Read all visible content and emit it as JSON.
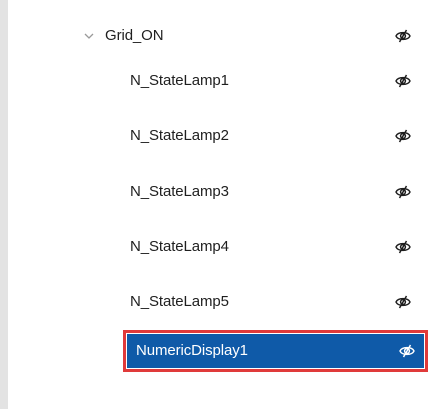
{
  "tree": {
    "group": {
      "label": "Grid_ON",
      "expanded": true,
      "expand_icon": "chevron-down-icon",
      "visibility_icon": "eye-icon"
    },
    "children": [
      {
        "label": "N_StateLamp1",
        "visibility_icon": "eye-icon"
      },
      {
        "label": "N_StateLamp2",
        "visibility_icon": "eye-icon"
      },
      {
        "label": "N_StateLamp3",
        "visibility_icon": "eye-icon"
      },
      {
        "label": "N_StateLamp4",
        "visibility_icon": "eye-icon"
      },
      {
        "label": "N_StateLamp5",
        "visibility_icon": "eye-icon"
      },
      {
        "label": "NumericDisplay1",
        "visibility_icon": "eye-icon",
        "selected": true
      }
    ]
  },
  "colors": {
    "selection_fill": "#0f5aa8",
    "highlight_outline": "#e03a3a",
    "text": "#1f1f1f",
    "panel_border": "#e3e3e3"
  }
}
